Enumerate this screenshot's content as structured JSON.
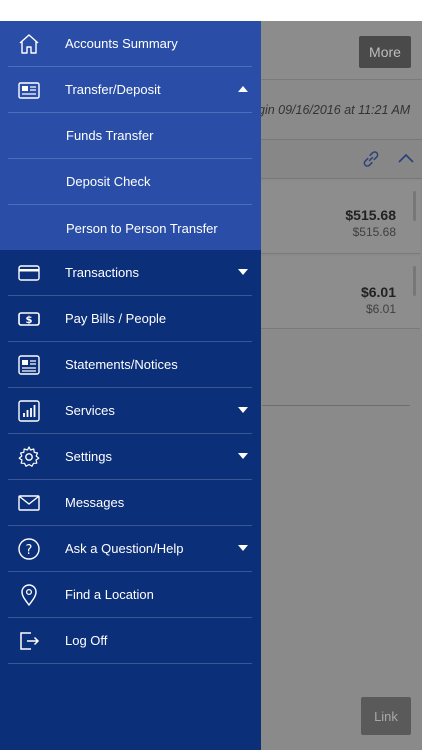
{
  "background": {
    "more_label": "More",
    "last_login": "gin 09/16/2016 at 11:21 AM",
    "accounts": [
      {
        "amount": "$515.68",
        "sub_amount": "$515.68"
      },
      {
        "amount": "$6.01",
        "sub_amount": "$6.01"
      }
    ],
    "link_label": "Link"
  },
  "drawer": {
    "items": [
      {
        "label": "Accounts Summary",
        "icon": "home-icon"
      },
      {
        "label": "Transfer/Deposit",
        "icon": "newspaper-icon",
        "caret": "up"
      },
      {
        "label": "Funds Transfer",
        "sub": true
      },
      {
        "label": "Deposit Check",
        "sub": true
      },
      {
        "label": "Person to Person Transfer",
        "sub": true
      },
      {
        "label": "Transactions",
        "icon": "credit-card-icon",
        "caret": "down"
      },
      {
        "label": "Pay Bills / People",
        "icon": "dollar-bill-icon"
      },
      {
        "label": "Statements/Notices",
        "icon": "statement-icon"
      },
      {
        "label": "Services",
        "icon": "chart-icon",
        "caret": "down"
      },
      {
        "label": "Settings",
        "icon": "gear-icon",
        "caret": "down"
      },
      {
        "label": "Messages",
        "icon": "envelope-icon"
      },
      {
        "label": "Ask a Question/Help",
        "icon": "question-icon",
        "caret": "down"
      },
      {
        "label": "Find a Location",
        "icon": "location-pin-icon"
      },
      {
        "label": "Log Off",
        "icon": "logout-icon"
      }
    ]
  },
  "colors": {
    "drawer_bg": "#0c2f79",
    "drawer_expanded_bg": "#2a4ea7",
    "overlay_bg": "#8a8a8a"
  }
}
